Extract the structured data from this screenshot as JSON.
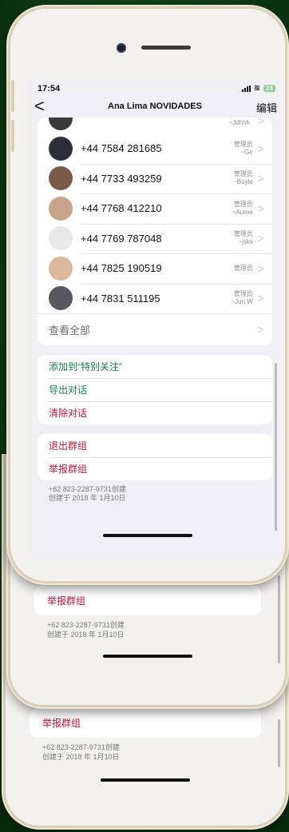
{
  "status_bar": {
    "time": "17:54",
    "battery": "24"
  },
  "nav": {
    "back_glyph": "<",
    "title": "Ana Lima NOVIDADES",
    "edit_label": "编辑"
  },
  "partial_member": {
    "role_name": "~Jdhhh"
  },
  "members": [
    {
      "phone": "+44 7584 281685",
      "role": "管理员",
      "name": "~Gir",
      "avatar_color": "#2a2f3a"
    },
    {
      "phone": "+44 7733 493259",
      "role": "管理员",
      "name": "~Boyle",
      "avatar_color": "#7a5a48"
    },
    {
      "phone": "+44 7768 412210",
      "role": "管理员",
      "name": "~Auroe",
      "avatar_color": "#c9a48a"
    },
    {
      "phone": "+44 7769 787048",
      "role": "管理员",
      "name": "~jsks",
      "avatar_color": "#e8e8e8"
    },
    {
      "phone": "+44 7825 190519",
      "role": "管理员",
      "name": "",
      "avatar_color": "#d9b79b"
    },
    {
      "phone": "+44 7831 511195",
      "role": "管理员",
      "name": "~Jun W",
      "avatar_color": "#55585e"
    }
  ],
  "see_all_label": "查看全部",
  "actions_group_1": [
    {
      "label": "添加到“特别关注”",
      "color": "#14804a"
    },
    {
      "label": "导出对话",
      "color": "#14804a"
    },
    {
      "label": "清除对话",
      "color": "#c0143c"
    }
  ],
  "actions_group_2": [
    {
      "label": "退出群组",
      "color": "#c0143c"
    },
    {
      "label": "举报群组",
      "color": "#c0143c"
    }
  ],
  "footer": {
    "creator": "+62 823-2287-9731创建",
    "created_on": "创建于 2018 年 1月10日"
  },
  "echo_2": {
    "report_label": "举报群组",
    "creator": "+62 823-2287-9731创建",
    "created_on": "创建于 2018 年 1月10日"
  },
  "echo_3": {
    "report_label": "举报群组",
    "creator": "+62 823-2287-9731创建",
    "created_on": "创建于 2018 年 1月10日"
  },
  "chevron_glyph": ">"
}
